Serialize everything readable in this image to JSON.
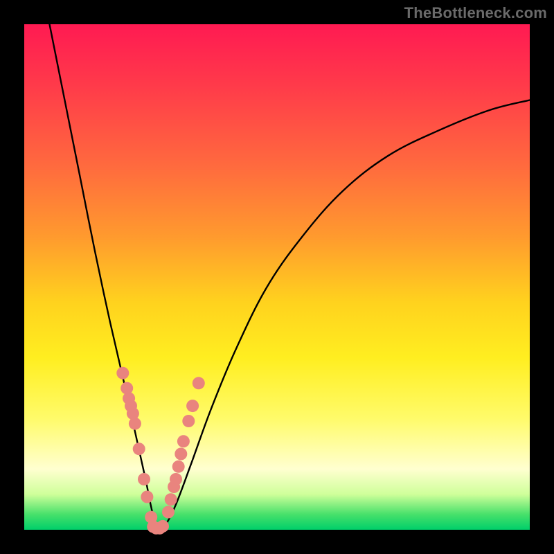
{
  "watermark": "TheBottleneck.com",
  "chart_data": {
    "type": "line",
    "title": "",
    "xlabel": "",
    "ylabel": "",
    "xlim": [
      0,
      100
    ],
    "ylim": [
      0,
      100
    ],
    "grid": false,
    "legend": false,
    "series": [
      {
        "name": "bottleneck-curve",
        "x": [
          5,
          8,
          11,
          14,
          17,
          20,
          22,
          24,
          25,
          26,
          27,
          28,
          30,
          33,
          37,
          42,
          48,
          55,
          63,
          72,
          82,
          92,
          100
        ],
        "y": [
          100,
          85,
          70,
          55,
          41,
          28,
          19,
          10,
          5,
          1,
          0,
          1,
          5,
          13,
          24,
          36,
          48,
          58,
          67,
          74,
          79,
          83,
          85
        ]
      }
    ],
    "markers_left": {
      "name": "left-cluster-dots",
      "x": [
        19.5,
        20.3,
        20.7,
        21.1,
        21.5,
        21.9,
        22.7,
        23.7,
        24.3,
        25.1
      ],
      "y": [
        31,
        28,
        26,
        24.5,
        23,
        21,
        16,
        10,
        6.5,
        2.5
      ]
    },
    "markers_right": {
      "name": "right-cluster-dots",
      "x": [
        28.5,
        29.0,
        29.6,
        30.0,
        30.5,
        31.0,
        31.5,
        32.5,
        33.3,
        34.5
      ],
      "y": [
        3.5,
        6,
        8.5,
        10,
        12.5,
        15,
        17.5,
        21.5,
        24.5,
        29
      ]
    },
    "markers_bottom": {
      "name": "trough-dots",
      "x": [
        25.5,
        26.1,
        26.8,
        27.4
      ],
      "y": [
        0.6,
        0.3,
        0.3,
        0.7
      ]
    },
    "colors": {
      "curve": "#000000",
      "marker": "#e9847e",
      "background_top": "#ff1a52",
      "background_bottom": "#00cf6a",
      "frame": "#000000"
    }
  }
}
